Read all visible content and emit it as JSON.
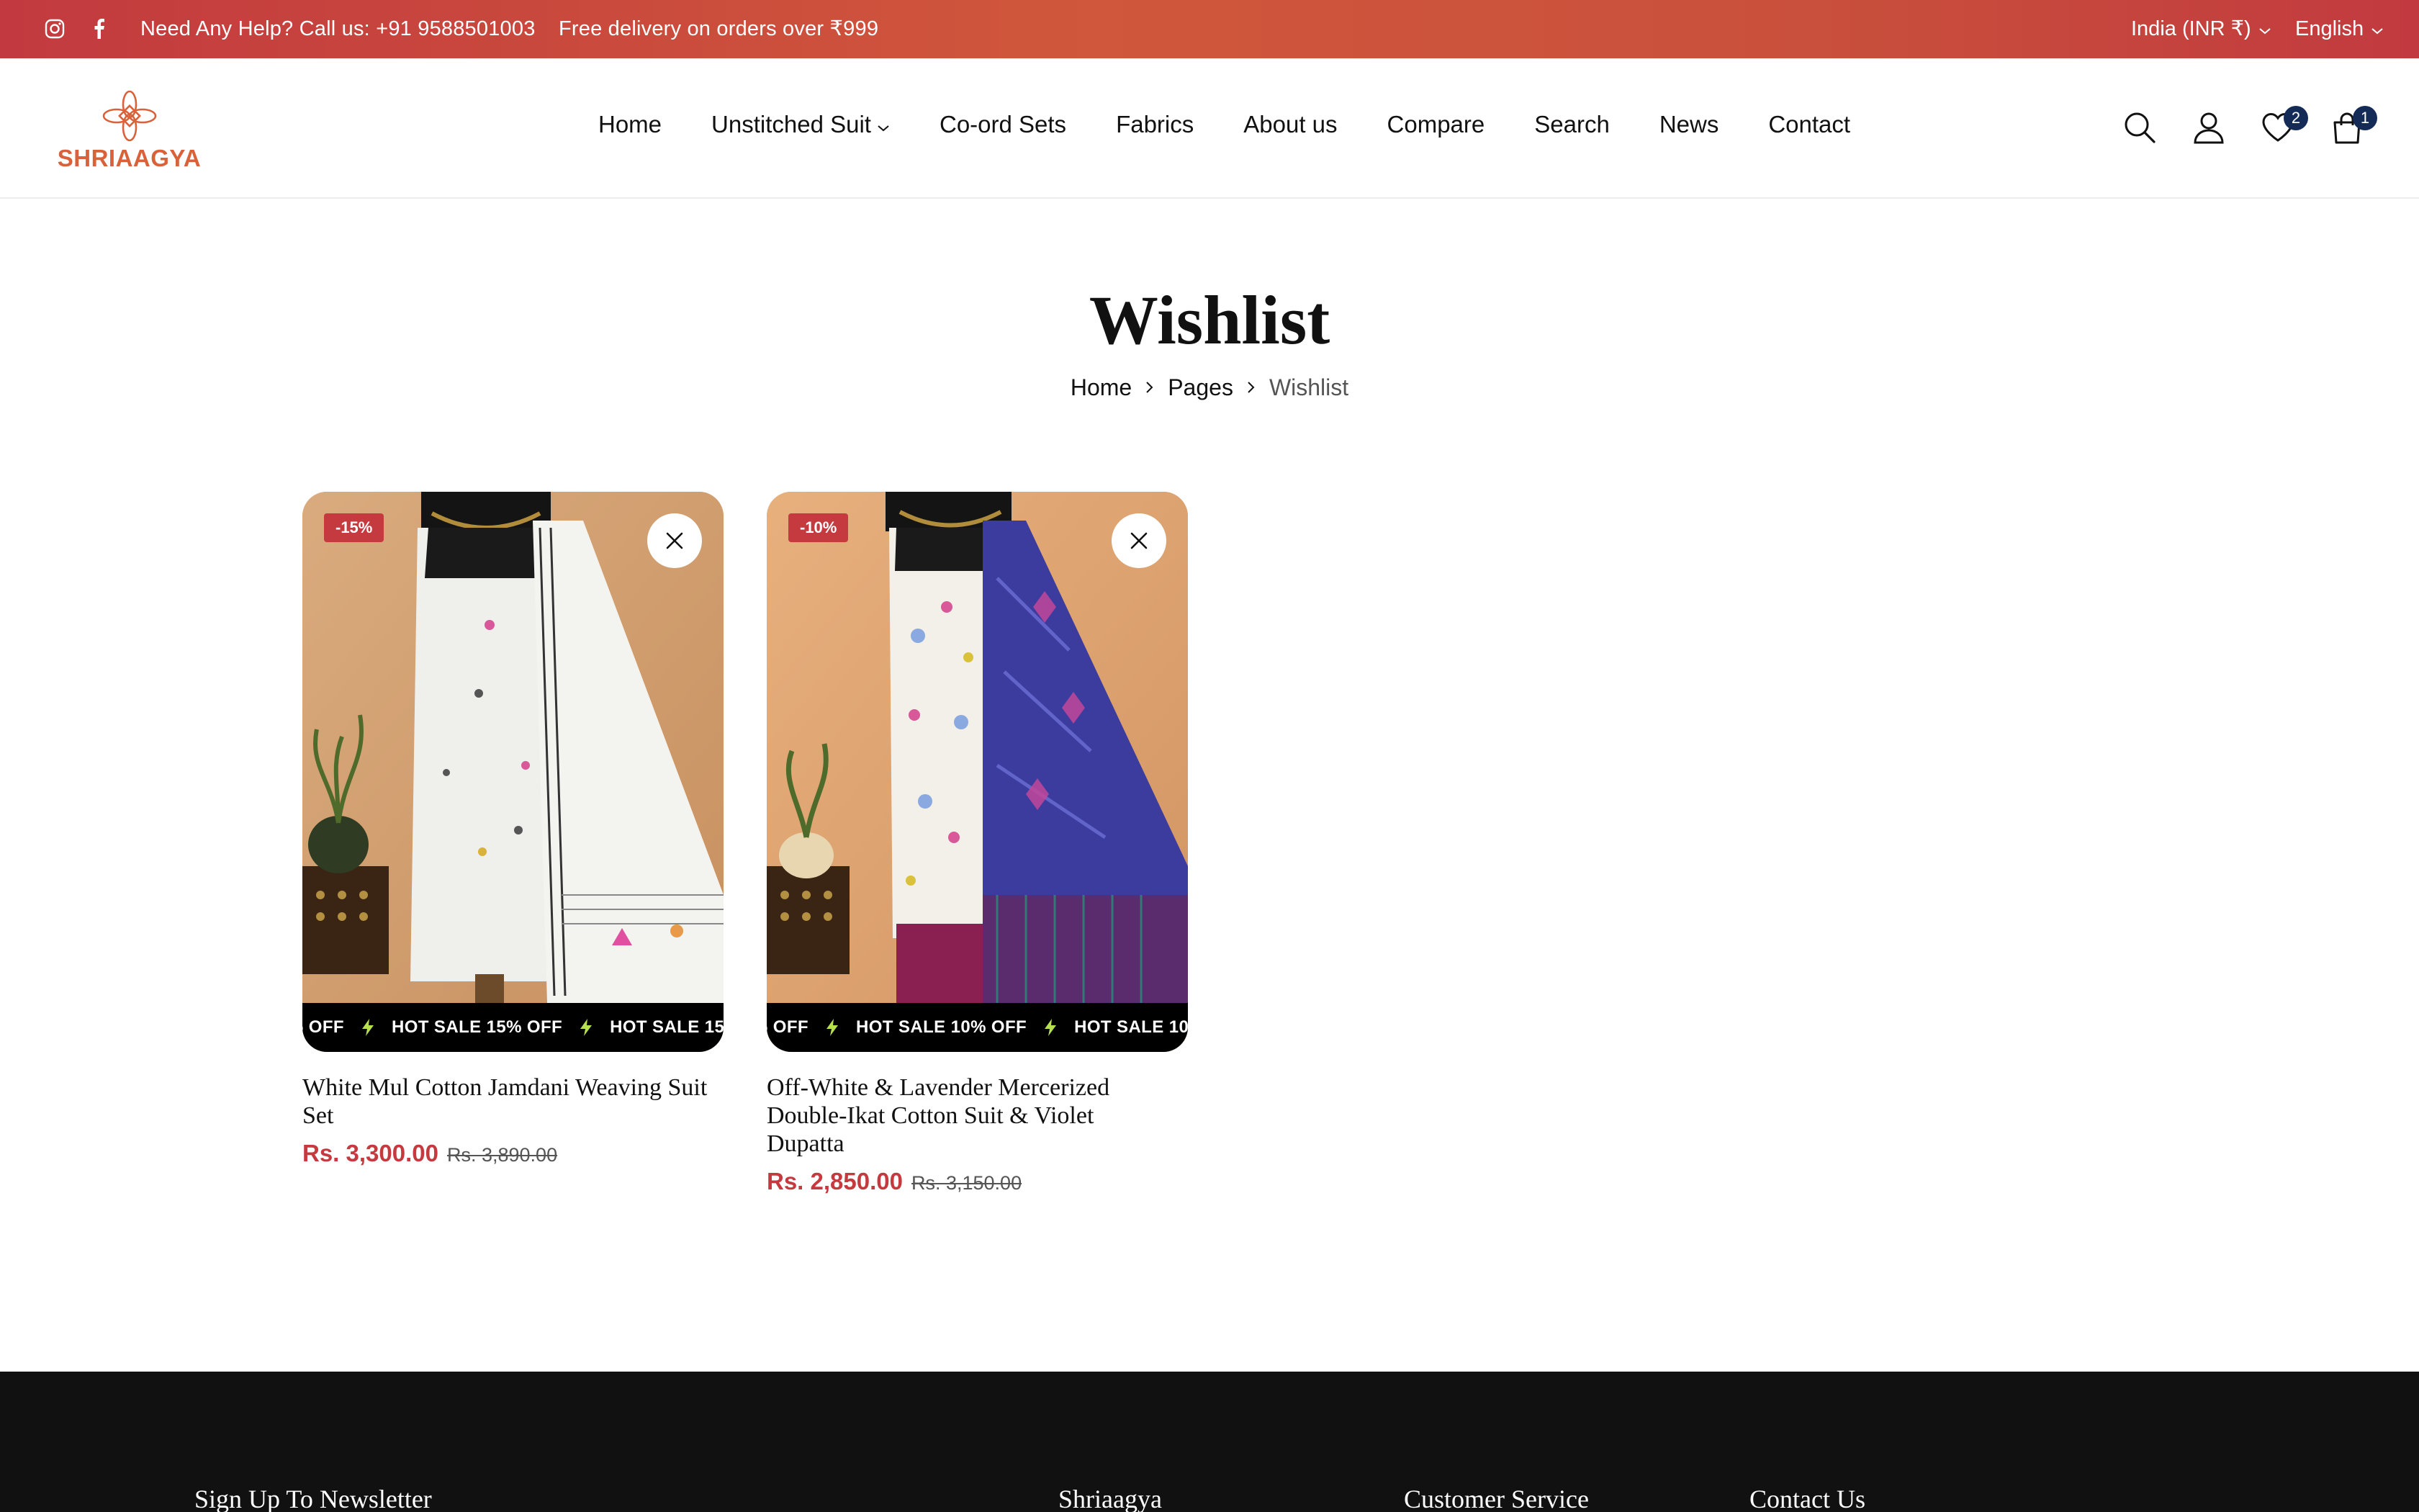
{
  "topbar": {
    "social": [
      "instagram-icon",
      "facebook-icon"
    ],
    "help_text": "Need Any Help? Call us: +91 9588501003",
    "promo_text": "Free delivery on orders over ₹999",
    "currency": "India (INR ₹)",
    "language": "English"
  },
  "header": {
    "logo_text": "SHRIAAGYA",
    "nav": [
      {
        "label": "Home"
      },
      {
        "label": "Unstitched Suit",
        "has_dropdown": true
      },
      {
        "label": "Co-ord Sets"
      },
      {
        "label": "Fabrics"
      },
      {
        "label": "About us"
      },
      {
        "label": "Compare"
      },
      {
        "label": "Search"
      },
      {
        "label": "News"
      },
      {
        "label": "Contact"
      }
    ],
    "icons": [
      "search-icon",
      "account-icon",
      "wishlist-icon",
      "cart-icon"
    ],
    "wishlist_count": "2",
    "cart_count": "1"
  },
  "page": {
    "title": "Wishlist",
    "breadcrumb": [
      "Home",
      "Pages",
      "Wishlist"
    ]
  },
  "products": [
    {
      "name": "White Mul Cotton Jamdani Weaving Suit Set",
      "discount": "-15%",
      "price": "Rs. 3,300.00",
      "compare_price": "Rs. 3,890.00",
      "ticker": "HOT SALE 15% OFF",
      "ticker_lead": "% OFF"
    },
    {
      "name": "Off-White & Lavender Mercerized Double-Ikat Cotton Suit & Violet Dupatta",
      "discount": "-10%",
      "price": "Rs. 2,850.00",
      "compare_price": "Rs. 3,150.00",
      "ticker": "HOT SALE 10% OFF",
      "ticker_lead": "% OFF"
    }
  ],
  "footer": {
    "columns": [
      "Sign Up To Newsletter",
      "Shriaagya",
      "Customer Service",
      "Contact Us"
    ]
  },
  "colors": {
    "topbar": "#c9503c",
    "accent": "#c43a3f",
    "badge": "#142a57",
    "logo": "#d9623a",
    "footer_bg": "#111111"
  }
}
